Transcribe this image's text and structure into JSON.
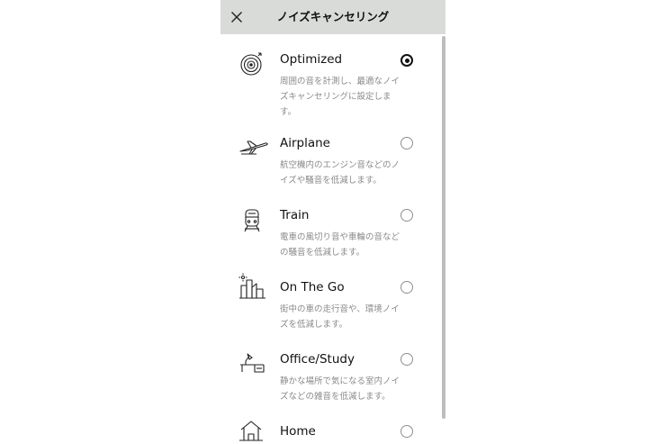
{
  "header": {
    "title": "ノイズキャンセリング",
    "close_icon": "close-icon"
  },
  "options": [
    {
      "label": "Optimized",
      "description": "周囲の音を計測し、最適なノイズキャンセリングに設定します。",
      "icon": "optimize-target-icon",
      "selected": true
    },
    {
      "label": "Airplane",
      "description": "航空機内のエンジン音などのノイズや騒音を低減します。",
      "icon": "airplane-icon",
      "selected": false
    },
    {
      "label": "Train",
      "description": "電車の風切り音や車輪の音などの騒音を低減します。",
      "icon": "train-icon",
      "selected": false
    },
    {
      "label": "On The Go",
      "description": "街中の車の走行音や、環境ノイズを低減します。",
      "icon": "city-icon",
      "selected": false
    },
    {
      "label": "Office/Study",
      "description": "静かな場所で気になる室内ノイズなどの雑音を低減します。",
      "icon": "desk-lamp-icon",
      "selected": false
    },
    {
      "label": "Home",
      "description": "",
      "icon": "home-icon",
      "selected": false
    }
  ],
  "colors": {
    "header_bg": "#d9dbd9",
    "text": "#111111",
    "description": "#8a8a8a",
    "radio_border": "#8f8f8f",
    "scrollbar": "#bdbdbd"
  }
}
